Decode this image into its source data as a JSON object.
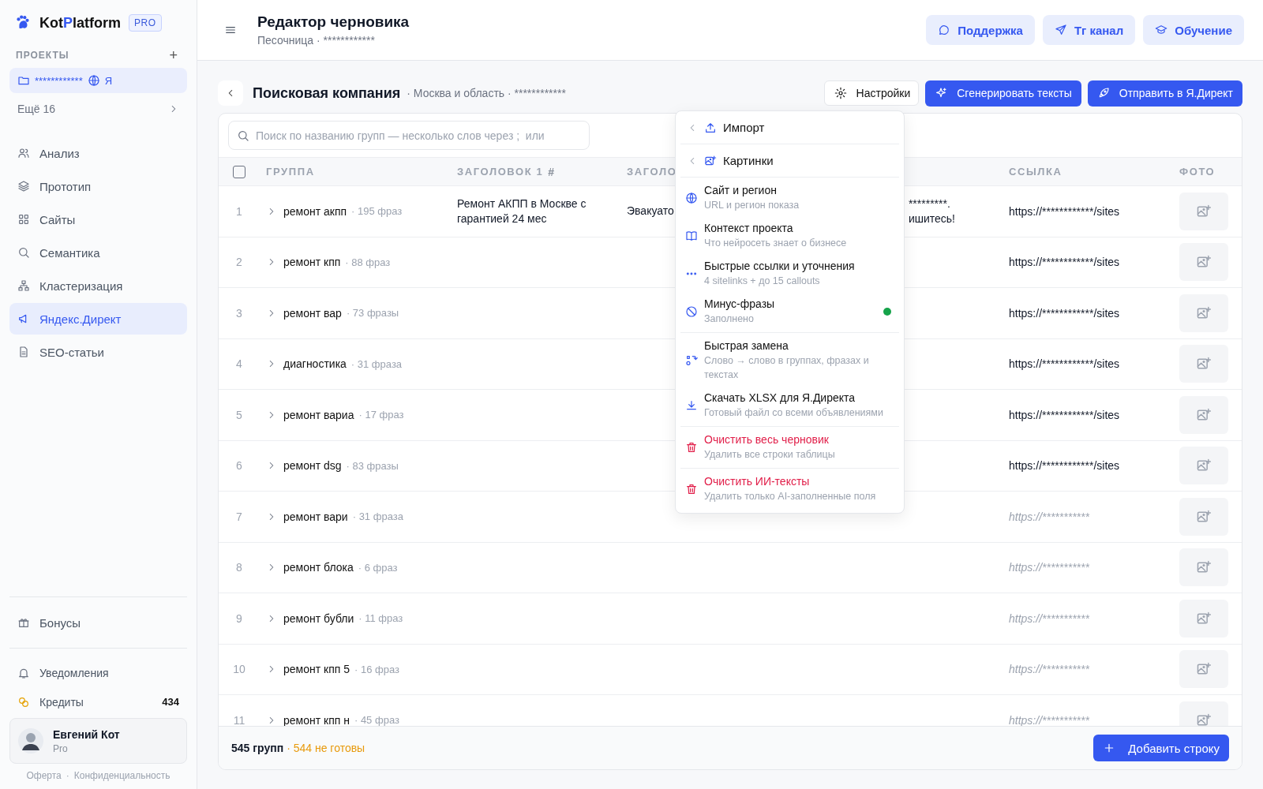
{
  "sidebar": {
    "logo": {
      "start": "Kot",
      "accent": "P",
      "end": "latform"
    },
    "plan_badge": "PRO",
    "projects_label": "ПРОЕКТЫ",
    "add_project": "+",
    "project": {
      "name": "************",
      "engine": "Я",
      "selected": true
    },
    "more": "Ещё 16",
    "items": [
      {
        "label": "Анализ",
        "selected": false
      },
      {
        "label": "Прототип",
        "selected": false
      },
      {
        "label": "Сайты",
        "selected": false
      },
      {
        "label": "Семантика",
        "selected": false
      },
      {
        "label": "Кластеризация",
        "selected": false
      },
      {
        "label": "Яндекс.Директ",
        "selected": true
      },
      {
        "label": "SEO-статьи",
        "selected": false
      }
    ],
    "bonus": "Бонусы",
    "notifications": "Уведомления",
    "credits": {
      "label": "Кредиты",
      "count": "434"
    },
    "user": {
      "name": "Евгений Кот",
      "plan": "Pro"
    },
    "links": [
      "Оферта",
      "Конфиденциальность"
    ],
    "link_separator": "·"
  },
  "header": {
    "title": "Редактор черновика",
    "subtitle": "Песочница · ************",
    "buttons": [
      "Поддержка",
      "Тг канал",
      "Обучение"
    ]
  },
  "toolbar": {
    "title": "Поисковая компания",
    "meta": "· Москва и область · ************",
    "settings": "Настройки",
    "generate": "Сгенерировать тексты",
    "send": "Отправить в Я.Директ"
  },
  "search": {
    "placeholder": "Поиск по названию групп — несколько слов через ;  или"
  },
  "table": {
    "select_all": {
      "checked": false
    },
    "columns": [
      "ГРУППА",
      "ЗАГОЛОВОК 1",
      "ЗАГОЛО",
      "",
      "ССЫЛКА",
      "ФОТО"
    ],
    "column_mark": "#",
    "rows": [
      {
        "n": "1",
        "group": "ремонт акпп",
        "phrases": "· 195 фраз",
        "title1": "Ремонт АКПП в Москве с гарантией 24 мес",
        "title2": "Эвакуато",
        "column_4": [
          "*********.",
          "ишитесь!"
        ],
        "link": {
          "text": "https://************/sites",
          "filled": true
        }
      },
      {
        "n": "2",
        "group": "ремонт кпп",
        "phrases": "· 88 фраз",
        "link": {
          "text": "https://************/sites",
          "filled": true
        }
      },
      {
        "n": "3",
        "group": "ремонт вар",
        "phrases": "· 73 фразы",
        "link": {
          "text": "https://************/sites",
          "filled": true
        }
      },
      {
        "n": "4",
        "group": "диагностика",
        "phrases": "· 31 фраза",
        "link": {
          "text": "https://************/sites",
          "filled": true
        }
      },
      {
        "n": "5",
        "group": "ремонт вариа",
        "phrases": "· 17 фраз",
        "link": {
          "text": "https://************/sites",
          "filled": true
        }
      },
      {
        "n": "6",
        "group": "ремонт dsg",
        "phrases": "· 83 фразы",
        "link": {
          "text": "https://************/sites",
          "filled": true
        }
      },
      {
        "n": "7",
        "group": "ремонт вари",
        "phrases": "· 31 фраза",
        "link": {
          "text": "https://***********",
          "filled": false
        }
      },
      {
        "n": "8",
        "group": "ремонт блока",
        "phrases": "· 6 фраз",
        "link": {
          "text": "https://***********",
          "filled": false
        }
      },
      {
        "n": "9",
        "group": "ремонт бубли",
        "phrases": "· 11 фраз",
        "link": {
          "text": "https://***********",
          "filled": false
        }
      },
      {
        "n": "10",
        "group": "ремонт кпп 5",
        "phrases": "· 16 фраз",
        "link": {
          "text": "https://***********",
          "filled": false
        }
      },
      {
        "n": "11",
        "group": "ремонт кпп н",
        "phrases": "· 45 фраз",
        "link": {
          "text": "https://***********",
          "filled": false
        }
      }
    ]
  },
  "footer": {
    "total": "545 групп",
    "not_ready": "· 544 не готовы",
    "add": "Добавить строку"
  },
  "menu": [
    [
      {
        "kind": "submenu",
        "title": "Импорт"
      }
    ],
    [
      {
        "kind": "submenu",
        "title": "Картинки"
      }
    ],
    [
      {
        "kind": "item",
        "title": "Сайт и регион",
        "subtitle": "URL и регион показа",
        "done": false
      },
      {
        "kind": "item",
        "title": "Контекст проекта",
        "subtitle": "Что нейросеть знает о бизнесе",
        "done": false
      },
      {
        "kind": "item",
        "title": "Быстрые ссылки и уточнения",
        "subtitle": "4 sitelinks + до 15 callouts",
        "done": false
      },
      {
        "kind": "item",
        "title": "Минус-фразы",
        "subtitle": "Заполнено",
        "done": true
      }
    ],
    [
      {
        "kind": "item",
        "title": "Быстрая замена",
        "subtitle": "Слово → слово в группах, фразах и текстах",
        "done": false
      },
      {
        "kind": "item",
        "title": "Скачать XLSX для Я.Директа",
        "subtitle": "Готовый файл со всеми объявлениями",
        "done": false
      }
    ],
    [
      {
        "kind": "danger",
        "title": "Очистить весь черновик",
        "subtitle": "Удалить все строки таблицы"
      }
    ],
    [
      {
        "kind": "danger",
        "title": "Очистить ИИ-тексты",
        "subtitle": "Удалить только AI-заполненные поля"
      }
    ]
  ]
}
